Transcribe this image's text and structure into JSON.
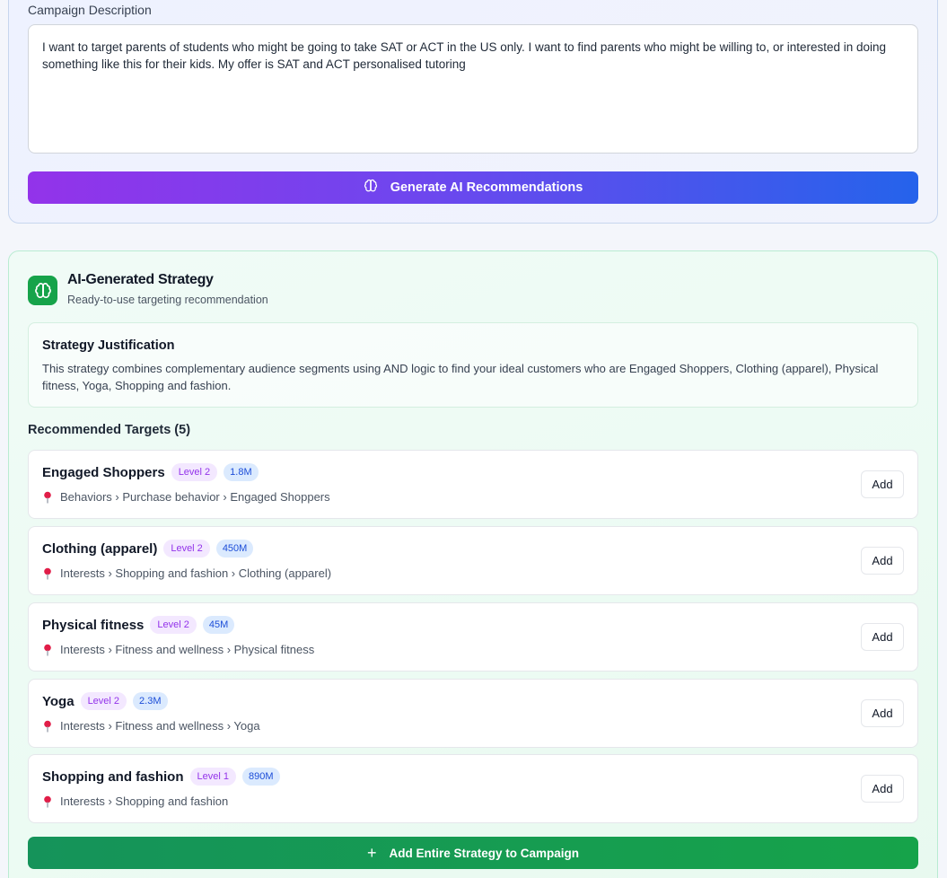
{
  "campaign": {
    "description_label": "Campaign Description",
    "description_value": "I want to target parents of students who might be going to take SAT or ACT in the US only. I want to find parents who might be willing to, or interested in doing something like this for their kids. My offer is SAT and ACT personalised tutoring",
    "generate_button_label": "Generate AI Recommendations",
    "generate_button_icon": "brain-icon"
  },
  "strategy": {
    "icon": "brain-icon",
    "title": "AI-Generated Strategy",
    "subtitle": "Ready-to-use targeting recommendation",
    "justification_title": "Strategy Justification",
    "justification_text": "This strategy combines complementary audience segments using AND logic to find your ideal customers who are Engaged Shoppers, Clothing (apparel), Physical fitness, Yoga, Shopping and fashion.",
    "recommended_title": "Recommended Targets (5)",
    "targets": [
      {
        "name": "Engaged Shoppers",
        "level": "Level 2",
        "size": "1.8M",
        "path": "Behaviors › Purchase behavior › Engaged Shoppers",
        "add_label": "Add"
      },
      {
        "name": "Clothing (apparel)",
        "level": "Level 2",
        "size": "450M",
        "path": "Interests › Shopping and fashion › Clothing (apparel)",
        "add_label": "Add"
      },
      {
        "name": "Physical fitness",
        "level": "Level 2",
        "size": "45M",
        "path": "Interests › Fitness and wellness › Physical fitness",
        "add_label": "Add"
      },
      {
        "name": "Yoga",
        "level": "Level 2",
        "size": "2.3M",
        "path": "Interests › Fitness and wellness › Yoga",
        "add_label": "Add"
      },
      {
        "name": "Shopping and fashion",
        "level": "Level 1",
        "size": "890M",
        "path": "Interests › Shopping and fashion",
        "add_label": "Add"
      }
    ],
    "add_all_label": "Add Entire Strategy to Campaign",
    "add_all_icon": "plus-icon"
  },
  "colors": {
    "generate_gradient_start": "#9333ea",
    "generate_gradient_end": "#2563eb",
    "strategy_accent": "#16a34a",
    "level_badge": "#9333ea",
    "size_badge": "#1d4ed8",
    "pin": "#e11d48"
  }
}
